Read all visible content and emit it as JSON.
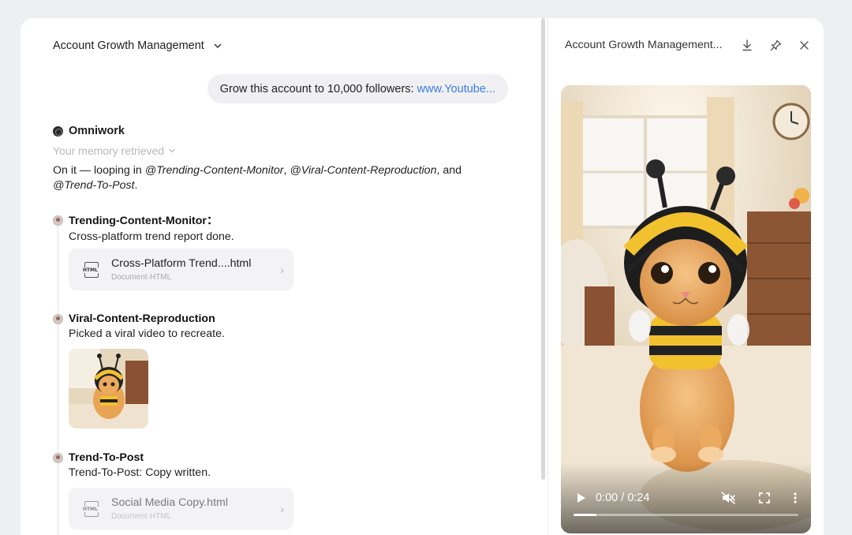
{
  "conversation": {
    "title": "Account Growth Management",
    "user_message": "Grow this account to 10,000 followers:",
    "user_link": "www.Youtube..."
  },
  "agent": {
    "name": "Omniwork",
    "memory": "Your memory retrieved",
    "summary_prefix": "On it — looping in ",
    "mention1": "@Trending-Content-Monitor",
    "sep1": ", ",
    "mention2": "@Viral-Content-Reproduction",
    "sep2": ", and",
    "mention3": "@Trend-To-Post",
    "summary_suffix": "."
  },
  "steps": [
    {
      "name": "Trending-Content-Monitor：",
      "desc": "Cross-platform trend report done.",
      "file": {
        "name": "Cross-Platform Trend....html",
        "type": "Document·HTML",
        "icon_text": "HTML"
      }
    },
    {
      "name": "Viral-Content-Reproduction",
      "desc": "Picked a viral video to recreate."
    },
    {
      "name": "Trend-To-Post",
      "desc": "Trend-To-Post: Copy written.",
      "file": {
        "name": "Social Media Copy.html",
        "type": "Document·HTML",
        "icon_text": "HTML"
      }
    }
  ],
  "preview": {
    "title": "Account Growth Management...",
    "video": {
      "current_time": "0:00",
      "separator": " / ",
      "duration": "0:24",
      "progress": 0.0
    }
  },
  "colors": {
    "accent_link": "#3b7de8",
    "background": "#eeeff2"
  }
}
